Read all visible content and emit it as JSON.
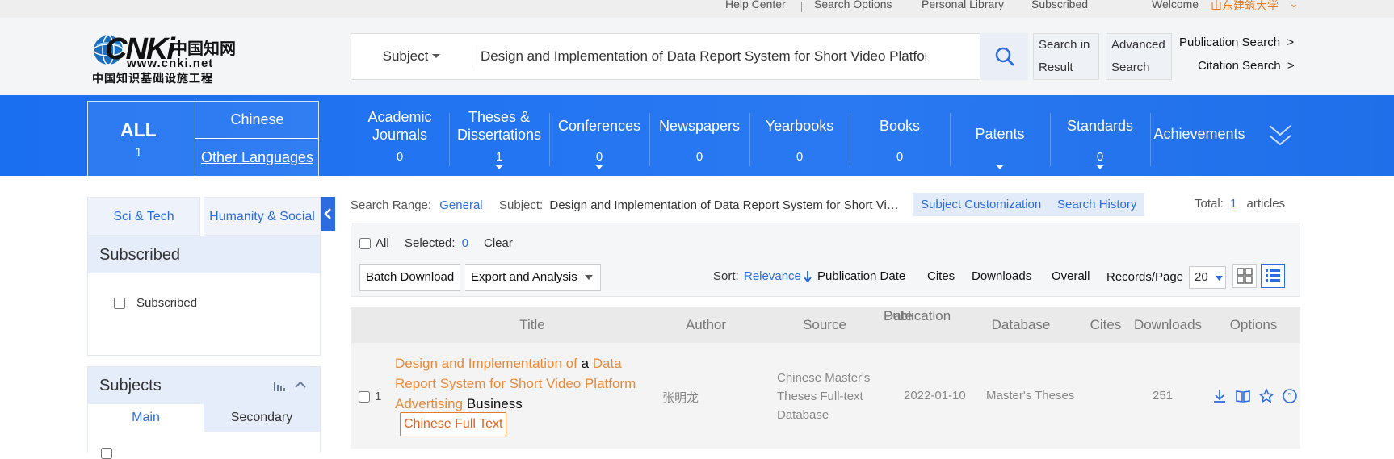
{
  "topbar": {
    "help_center": "Help Center",
    "search_options": "Search Options",
    "personal_library": "Personal Library",
    "subscribed": "Subscribed",
    "welcome": "Welcome",
    "user": "山东建筑大学"
  },
  "logo": {
    "brand": "CNKi",
    "cn_title": "中国知网",
    "url": "www.cnki.net",
    "tagline": "中国知识基础设施工程"
  },
  "search": {
    "field": "Subject",
    "query": "Design and Implementation of Data Report System for Short Video Platform Advertising Business",
    "search_in_result": [
      "Search in",
      "Result"
    ],
    "advanced_search": [
      "Advanced",
      "Search"
    ],
    "publication_search": "Publication Search",
    "citation_search": "Citation Search",
    "arrow": ">"
  },
  "nav": {
    "all": {
      "label": "ALL",
      "count": "1"
    },
    "chinese": "Chinese",
    "other_languages": "Other Languages",
    "items": [
      {
        "label": "Academic Journals",
        "count": "0"
      },
      {
        "label": "Theses & Dissertations",
        "count": "1"
      },
      {
        "label": "Conferences",
        "count": "0"
      },
      {
        "label": "Newspapers",
        "count": "0"
      },
      {
        "label": "Yearbooks",
        "count": "0"
      },
      {
        "label": "Books",
        "count": "0"
      },
      {
        "label": "Patents",
        "count": ""
      },
      {
        "label": "Standards",
        "count": "0"
      },
      {
        "label": "Achievements",
        "count": ""
      }
    ]
  },
  "sidebar": {
    "tab_scitech": "Sci & Tech",
    "tab_humanity": "Humanity & Social",
    "subscribed_title": "Subscribed",
    "subscribed_checkbox": "Subscribed",
    "subjects_title": "Subjects",
    "subjects_tabs": {
      "main": "Main",
      "secondary": "Secondary"
    }
  },
  "results": {
    "search_range_label": "Search Range:",
    "search_range_value": "General",
    "subject_label": "Subject:",
    "subject_value": "Design and Implementation of Data Report System for Short Vi…",
    "subject_customization": "Subject Customization",
    "search_history": "Search History",
    "total_label": "Total:",
    "total_value": "1",
    "total_unit": "articles",
    "all_label": "All",
    "selected_label": "Selected:",
    "selected_value": "0",
    "clear": "Clear",
    "batch_download": "Batch Download",
    "export_analysis": "Export and Analysis",
    "sort_label": "Sort:",
    "sort_options": [
      "Relevance",
      "Publication Date",
      "Cites",
      "Downloads",
      "Overall"
    ],
    "records_per_page_label": "Records/Page",
    "records_per_page_value": "20"
  },
  "table": {
    "headers": {
      "title": "Title",
      "author": "Author",
      "source": "Source",
      "pub_date": [
        "Publication",
        "Date"
      ],
      "database": "Database",
      "cites": "Cites",
      "downloads": "Downloads",
      "options": "Options"
    },
    "rows": [
      {
        "index": "1",
        "title_parts": [
          "Design and Implementation of",
          " a ",
          "Data Report System for Short Video Platform Advertising",
          " Business"
        ],
        "fulltext": "Chinese Full Text",
        "author": "张明龙",
        "source": [
          "Chinese Master's",
          "Theses Full-text",
          "Database"
        ],
        "pub_date": "2022-01-10",
        "database": "Master's Theses",
        "cites": "",
        "downloads": "251"
      }
    ]
  },
  "colors": {
    "nav_blue": "#1a6ef0",
    "link_blue": "#2d6ce0",
    "highlight_orange": "#e88a3a"
  }
}
